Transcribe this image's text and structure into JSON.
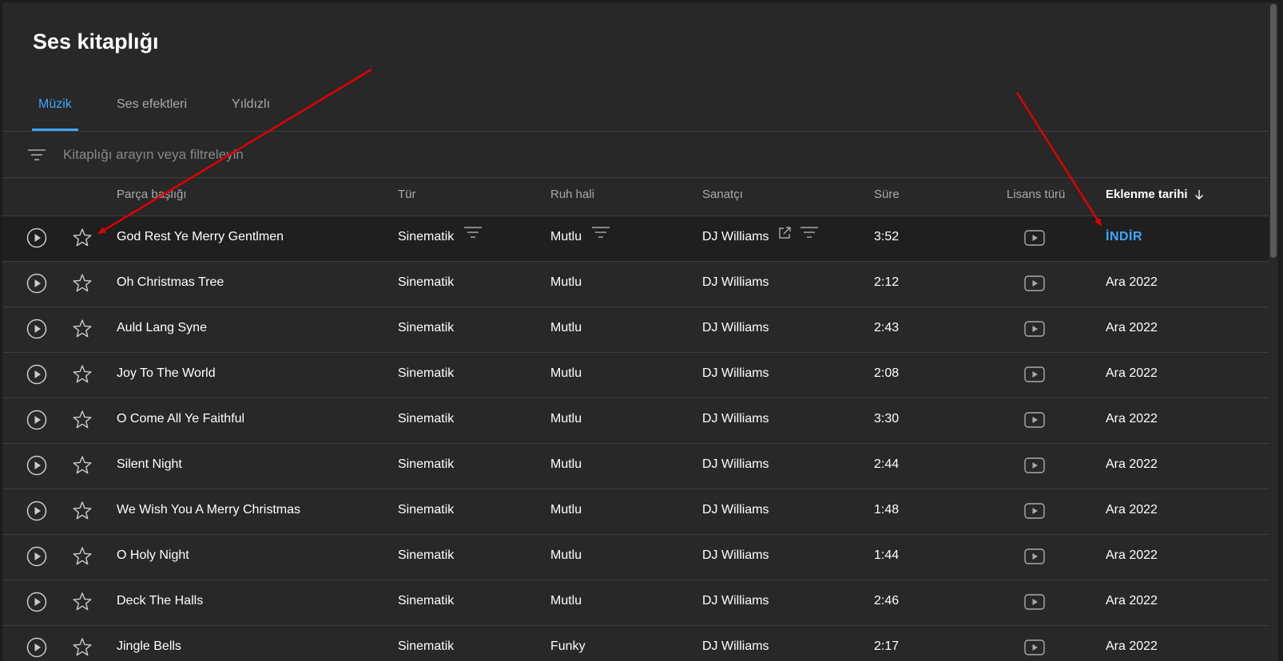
{
  "page_title": "Ses kitaplığı",
  "tabs": [
    {
      "label": "Müzik",
      "active": true
    },
    {
      "label": "Ses efektleri",
      "active": false
    },
    {
      "label": "Yıldızlı",
      "active": false
    }
  ],
  "search": {
    "placeholder": "Kitaplığı arayın veya filtreleyin"
  },
  "columns": {
    "title": "Parça başlığı",
    "genre": "Tür",
    "mood": "Ruh hali",
    "artist": "Sanatçı",
    "duration": "Süre",
    "license": "Lisans türü",
    "added": "Eklenme tarihi"
  },
  "rows": [
    {
      "title": "God Rest Ye Merry Gentlmen",
      "genre": "Sinematik",
      "mood": "Mutlu",
      "artist": "DJ Williams",
      "duration": "3:52",
      "added": "İNDİR"
    },
    {
      "title": "Oh Christmas Tree",
      "genre": "Sinematik",
      "mood": "Mutlu",
      "artist": "DJ Williams",
      "duration": "2:12",
      "added": "Ara 2022"
    },
    {
      "title": "Auld Lang Syne",
      "genre": "Sinematik",
      "mood": "Mutlu",
      "artist": "DJ Williams",
      "duration": "2:43",
      "added": "Ara 2022"
    },
    {
      "title": "Joy To The World",
      "genre": "Sinematik",
      "mood": "Mutlu",
      "artist": "DJ Williams",
      "duration": "2:08",
      "added": "Ara 2022"
    },
    {
      "title": "O Come All Ye Faithful",
      "genre": "Sinematik",
      "mood": "Mutlu",
      "artist": "DJ Williams",
      "duration": "3:30",
      "added": "Ara 2022"
    },
    {
      "title": "Silent Night",
      "genre": "Sinematik",
      "mood": "Mutlu",
      "artist": "DJ Williams",
      "duration": "2:44",
      "added": "Ara 2022"
    },
    {
      "title": "We Wish You A Merry Christmas",
      "genre": "Sinematik",
      "mood": "Mutlu",
      "artist": "DJ Williams",
      "duration": "1:48",
      "added": "Ara 2022"
    },
    {
      "title": "O Holy Night",
      "genre": "Sinematik",
      "mood": "Mutlu",
      "artist": "DJ Williams",
      "duration": "1:44",
      "added": "Ara 2022"
    },
    {
      "title": "Deck The Halls",
      "genre": "Sinematik",
      "mood": "Mutlu",
      "artist": "DJ Williams",
      "duration": "2:46",
      "added": "Ara 2022"
    },
    {
      "title": "Jingle Bells",
      "genre": "Sinematik",
      "mood": "Funky",
      "artist": "DJ Williams",
      "duration": "2:17",
      "added": "Ara 2022"
    }
  ],
  "colors": {
    "accent": "#3ea6ff",
    "annotation": "#e00000",
    "background": "#282828"
  }
}
